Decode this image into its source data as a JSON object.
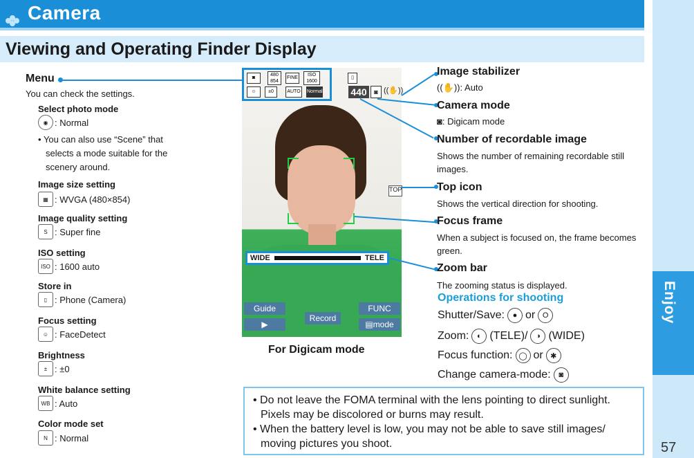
{
  "header": {
    "chapter_title": "Camera"
  },
  "side_tab": {
    "label": "Enjoy"
  },
  "page_number": "57",
  "section": {
    "title": "Viewing and Operating Finder Display"
  },
  "menu": {
    "title": "Menu",
    "description": "You can check the settings.",
    "items": [
      {
        "title": "Select photo mode",
        "value": ": Normal",
        "icon": "photo-mode-icon"
      },
      {
        "title": "Image size setting",
        "value": ": WVGA (480×854)",
        "icon": "image-size-icon"
      },
      {
        "title": "Image quality setting",
        "value": ": Super fine",
        "icon": "image-quality-icon"
      },
      {
        "title": "ISO setting",
        "value": ": 1600 auto",
        "icon": "iso-icon"
      },
      {
        "title": "Store in",
        "value": ": Phone (Camera)",
        "icon": "store-in-icon"
      },
      {
        "title": "Focus setting",
        "value": ": FaceDetect",
        "icon": "focus-setting-icon"
      },
      {
        "title": "Brightness",
        "value": ": ±0",
        "icon": "brightness-icon"
      },
      {
        "title": "White balance setting",
        "value": ": Auto",
        "icon": "white-balance-icon"
      },
      {
        "title": "Color mode set",
        "value": ": Normal",
        "icon": "color-mode-icon"
      }
    ],
    "bullet": "You can also use “Scene” that selects a mode suitable for the scenery around."
  },
  "screen": {
    "counter": "440",
    "zoom_left": "WIDE",
    "zoom_right": "TELE",
    "softkeys": {
      "left": "Guide",
      "center": "Record",
      "right": "FUNC",
      "right2": "mode"
    },
    "icons": {
      "size_top": "480",
      "size_bottom": "854",
      "quality": "FINE",
      "iso": "ISO",
      "iso_val": "1600",
      "brightness": "±0",
      "wb": "AUTO",
      "color": "Normal",
      "top": "TOP"
    }
  },
  "caption": "For Digicam mode",
  "callouts": [
    {
      "title": "Image stabilizer",
      "desc": ": Auto"
    },
    {
      "title": "Camera mode",
      "desc": ": Digicam mode"
    },
    {
      "title": "Number of recordable image",
      "desc": "Shows the number of remaining recordable still images."
    },
    {
      "title": "Top icon",
      "desc": "Shows the vertical direction for shooting."
    },
    {
      "title": "Focus frame",
      "desc": "When a subject is focused on, the frame becomes green."
    },
    {
      "title": "Zoom bar",
      "desc": "The zooming status is displayed."
    }
  ],
  "operations": {
    "title": "Operations for shooting",
    "shutter_label": "Shutter/Save:",
    "or1": "or",
    "zoom_label": "Zoom:",
    "zoom_tele": "(TELE)/",
    "zoom_wide": "(WIDE)",
    "focus_label": "Focus function:",
    "or2": "or",
    "change_label": "Change camera-mode:"
  },
  "notes": [
    "Do not leave the FOMA terminal with the lens pointing to direct sunlight. Pixels may be discolored or burns may result.",
    "When the battery level is low, you may not be able to save still images/ moving pictures you shoot."
  ],
  "colors": {
    "accent": "#1a8fd8",
    "ops_title": "#1a9ed8",
    "frame_green": "#22cc44"
  }
}
